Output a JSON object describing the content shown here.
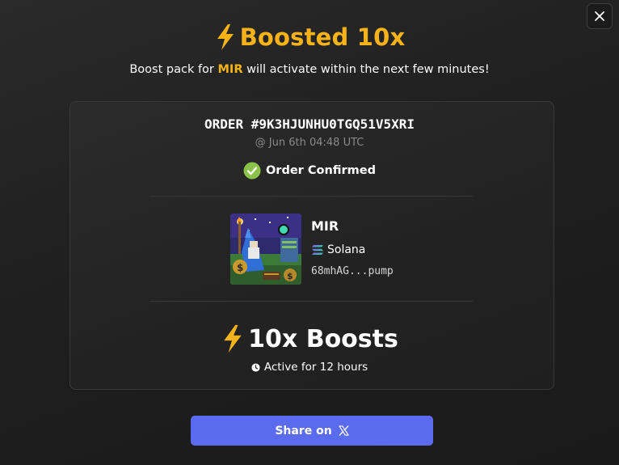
{
  "title": "Boosted 10x",
  "subtitle": {
    "before": "Boost pack for ",
    "token": "MIR",
    "after": " will activate within the next few minutes!"
  },
  "order": {
    "id": "ORDER #9K3HJUNHU0TGQ51V5XRI",
    "time": "@ Jun 6th 04:48 UTC",
    "status": "Order Confirmed"
  },
  "token": {
    "name": "MIR",
    "chain": "Solana",
    "address": "68mhAG...pump",
    "image_icon": "wizard-token-art"
  },
  "boosts": {
    "label": "10x Boosts",
    "duration": "Active for 12 hours"
  },
  "share": {
    "label": "Share on",
    "icon": "x-logo-icon"
  },
  "colors": {
    "accent": "#f6b317",
    "button": "#5b6bf0",
    "confirmed": "#8bc34a",
    "background": "#222222"
  }
}
